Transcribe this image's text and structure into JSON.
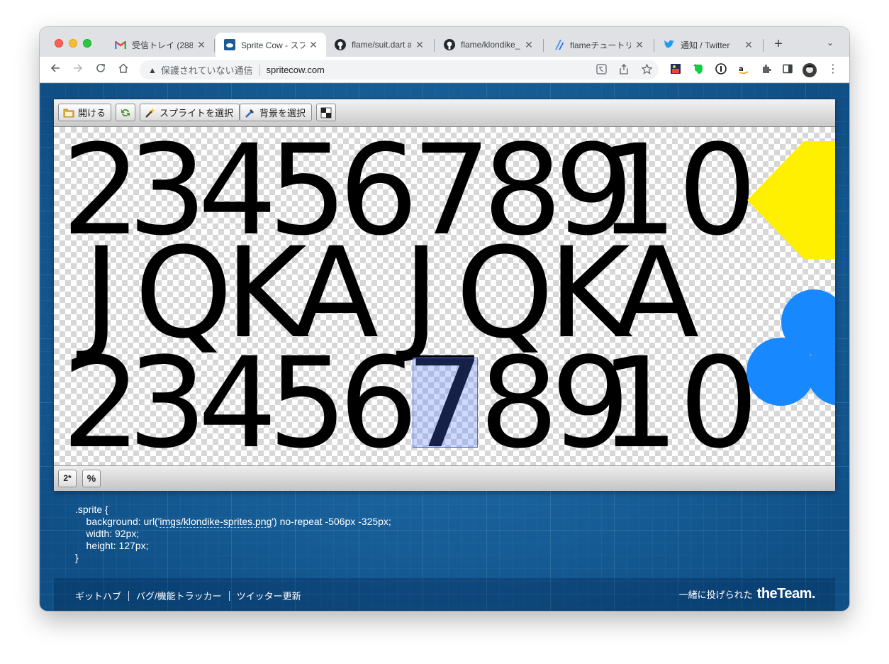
{
  "browser": {
    "tabs": [
      {
        "icon": "gmail-icon",
        "label": "受信トレイ (288)",
        "close": "✕"
      },
      {
        "icon": "spritecow-icon",
        "label": "Sprite Cow - スプ",
        "close": "✕"
      },
      {
        "icon": "github-icon",
        "label": "flame/suit.dart a",
        "close": "✕"
      },
      {
        "icon": "github-icon",
        "label": "flame/klondike_",
        "close": "✕"
      },
      {
        "icon": "flame-docs-icon",
        "label": "flameチュートリ",
        "close": "✕"
      },
      {
        "icon": "twitter-icon",
        "label": "通知 / Twitter",
        "close": "✕"
      }
    ],
    "new_tab": "+",
    "tab_menu": "⌄",
    "address": {
      "security_icon": "▲",
      "security_text": "保護されていない通信",
      "url": "spritecow.com"
    }
  },
  "app": {
    "toolbar": {
      "open_label": "開ける",
      "select_sprite_label": "スプライトを選択",
      "select_bg_label": "背景を選択"
    },
    "bottom": {
      "scale_label": "2*",
      "percent_label": "%"
    },
    "sheet": {
      "yellow_color": "#FFF000",
      "blue_color": "#1888FF",
      "selection_color": "#4A6FE0",
      "glyphs": [
        {
          "text": "2",
          "color": "yellow"
        },
        {
          "text": "3",
          "color": "yellow"
        },
        {
          "text": "4",
          "color": "yellow"
        },
        {
          "text": "5",
          "color": "yellow"
        },
        {
          "text": "6",
          "color": "yellow"
        },
        {
          "text": "7",
          "color": "yellow"
        },
        {
          "text": "8",
          "color": "yellow"
        },
        {
          "text": "9",
          "color": "yellow"
        },
        {
          "text": "10",
          "color": "yellow"
        },
        {
          "text": "J",
          "color": "yellow"
        },
        {
          "text": "Q",
          "color": "yellow"
        },
        {
          "text": "K",
          "color": "yellow"
        },
        {
          "text": "A",
          "color": "yellow"
        },
        {
          "text": "J",
          "color": "blue"
        },
        {
          "text": "Q",
          "color": "blue"
        },
        {
          "text": "K",
          "color": "blue"
        },
        {
          "text": "A",
          "color": "blue"
        },
        {
          "text": "2",
          "color": "blue"
        },
        {
          "text": "3",
          "color": "blue"
        },
        {
          "text": "4",
          "color": "blue"
        },
        {
          "text": "5",
          "color": "blue"
        },
        {
          "text": "6",
          "color": "blue"
        },
        {
          "text": "7",
          "color": "blue"
        },
        {
          "text": "8",
          "color": "blue"
        },
        {
          "text": "9",
          "color": "blue"
        },
        {
          "text": "10",
          "color": "blue"
        }
      ]
    },
    "css_output": {
      "line1": ".sprite {",
      "line2_prefix": "    background: url('",
      "line2_path": "imgs/klondike-sprites.png",
      "line2_suffix": "') no-repeat -506px -325px;",
      "line3": "    width: 92px;",
      "line4": "    height: 127px;",
      "line5": "}"
    },
    "footer": {
      "links": [
        "ギットハブ",
        "バグ/機能トラッカー",
        "ツイッター更新"
      ],
      "credit_text": "一緒に投げられた",
      "credit_logo": "theTeam."
    }
  }
}
